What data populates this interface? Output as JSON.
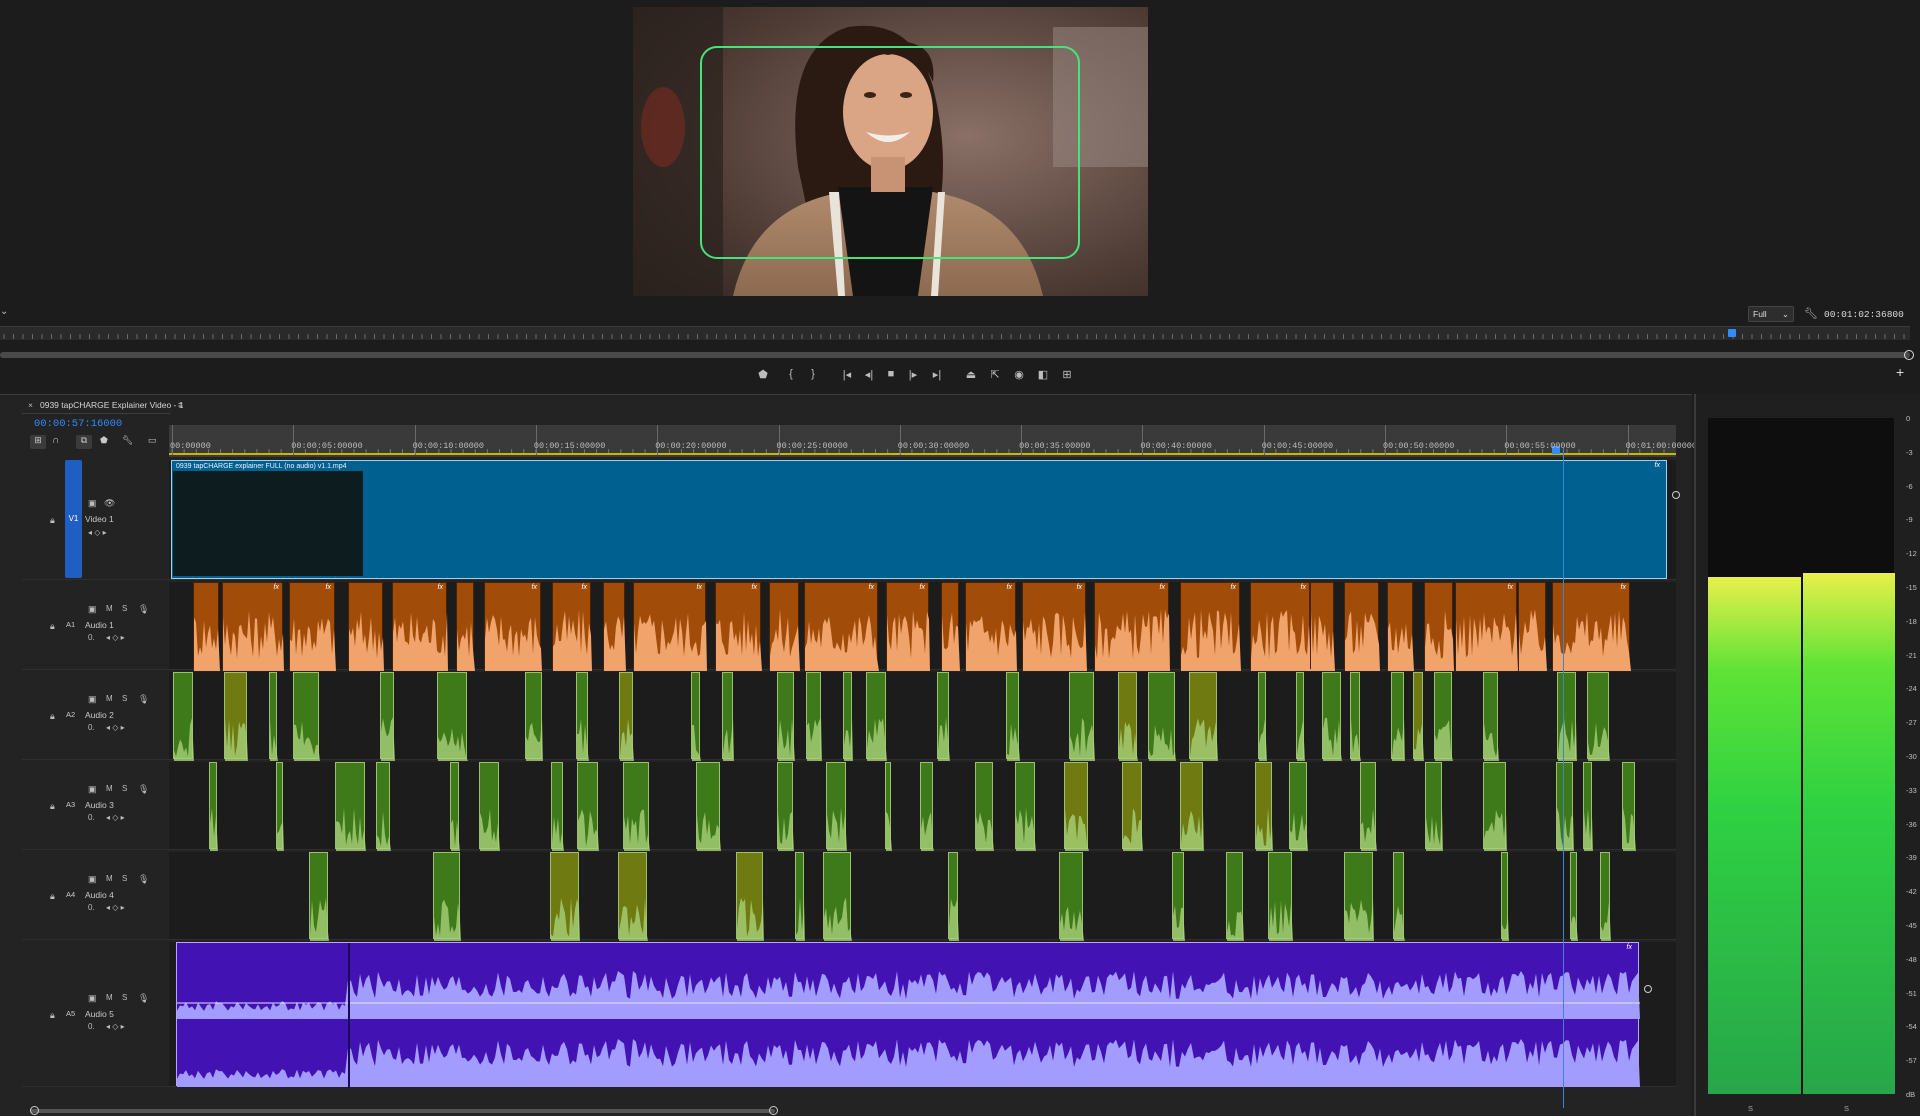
{
  "program_monitor": {
    "fit_value": "Full",
    "timecode": "00:01:02:36800",
    "controls": [
      "marker-icon",
      "mark-in-icon",
      "mark-out-icon",
      "go-to-in-icon",
      "step-back-icon",
      "stop-icon",
      "play-icon",
      "go-to-out-icon",
      "lift-icon",
      "extract-icon",
      "export-frame-icon",
      "compare-icon",
      "multi-camera-icon"
    ],
    "playhead_fraction": 0.885
  },
  "timeline": {
    "sequence_name": "0939 tapCHARGE Explainer Video - 1",
    "current_timecode": "00:00:57:16000",
    "ruler_ticks": [
      "00:00000",
      "00:00:05:00000",
      "00:00:10:00000",
      "00:00:15:00000",
      "00:00:20:00000",
      "00:00:25:00000",
      "00:00:30:00000",
      "00:00:35:00000",
      "00:00:40:00000",
      "00:00:45:00000",
      "00:00:50:00000",
      "00:00:55:00000",
      "00:01:00:00000"
    ],
    "playhead_fraction": 0.917,
    "tracks": [
      {
        "id": "V1",
        "name": "Video 1",
        "type": "video"
      },
      {
        "id": "A1",
        "name": "Audio 1",
        "type": "audio"
      },
      {
        "id": "A2",
        "name": "Audio 2",
        "type": "audio"
      },
      {
        "id": "A3",
        "name": "Audio 3",
        "type": "audio"
      },
      {
        "id": "A4",
        "name": "Audio 4",
        "type": "audio"
      },
      {
        "id": "A5",
        "name": "Audio 5",
        "type": "audio"
      }
    ],
    "audio_level_value": "0.",
    "video_clip_name": "0939 tapCHARGE explainer FULL (no audio) v1.1.mp4",
    "fx_label": "fx",
    "mute_label": "M",
    "solo_label": "S"
  },
  "meter": {
    "scale": [
      "0",
      "-3",
      "-6",
      "-9",
      "-12",
      "-15",
      "-18",
      "-21",
      "-24",
      "-27",
      "-30",
      "-33",
      "-36",
      "-39",
      "-42",
      "-45",
      "-48",
      "-51",
      "-54",
      "-57",
      "dB"
    ],
    "channel_labels": [
      "S",
      "S"
    ],
    "level_fractions": [
      0.765,
      0.77
    ]
  },
  "colors": {
    "video_clip": "#00608f",
    "audio1": "#a24c0a",
    "audio1_wave": "#f0a36b",
    "audio_green": "#3f7a1a",
    "audio5": "#4312b3",
    "audio5_wave": "#a29cff",
    "accent": "#2d8cff"
  }
}
